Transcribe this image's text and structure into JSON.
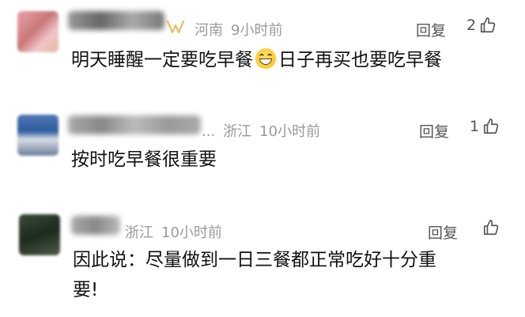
{
  "comments": [
    {
      "region": "河南",
      "time": "9小时前",
      "reply_label": "回复",
      "likes": "2",
      "text_before_emoji": "明天睡醒一定要吃早餐",
      "emoji": "grinning-face",
      "text_after_emoji": "日子再买也要吃早餐"
    },
    {
      "name_suffix": "...",
      "region": "浙江",
      "time": "10小时前",
      "reply_label": "回复",
      "likes": "1",
      "text": "按时吃早餐很重要"
    },
    {
      "region": "浙江",
      "time": "10小时前",
      "reply_label": "回复",
      "likes": "",
      "text_line1": "因此说：尽量做到一日三餐都正常吃好十分重",
      "text_line2": "要!"
    }
  ],
  "colors": {
    "meta_gray": "#9a9a9a",
    "text": "#111111",
    "action_gray": "#555555",
    "vip_gold": "#e6c26a"
  },
  "icons": [
    "thumbs-up-icon",
    "vip-badge-icon",
    "grinning-emoji-icon"
  ]
}
